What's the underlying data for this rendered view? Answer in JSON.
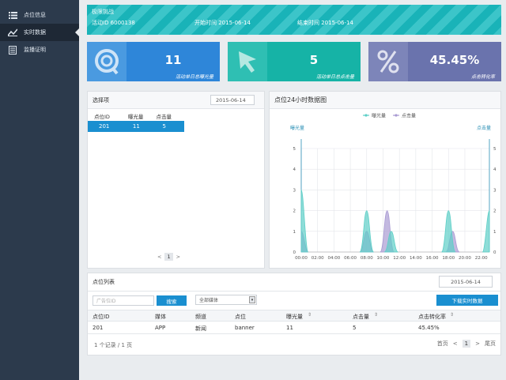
{
  "sidebar": {
    "items": [
      {
        "label": "点位信息",
        "icon": "list-icon"
      },
      {
        "label": "实时数据",
        "icon": "chart-line-icon"
      },
      {
        "label": "监播证明",
        "icon": "document-icon"
      }
    ]
  },
  "banner": {
    "name": "极限挑战",
    "activity_id": "活动ID 6000138",
    "start": "开始时间 2015-06-14",
    "end": "结束时间 2015-06-14"
  },
  "cards": [
    {
      "value": "11",
      "label": "活动单日总曝光量",
      "icon": "magnifier-icon",
      "color": "#2e86d9"
    },
    {
      "value": "5",
      "label": "活动单日总点击量",
      "icon": "cursor-icon",
      "color": "#16b3a6"
    },
    {
      "value": "45.45%",
      "label": "点击转化率",
      "icon": "percent-icon",
      "color": "#6a73ad"
    }
  ],
  "selector": {
    "title": "选择项",
    "date": "2015-06-14",
    "headers": [
      "点位ID",
      "曝光量",
      "点击量"
    ],
    "rows": [
      [
        "201",
        "11",
        "5"
      ]
    ],
    "pager_prev": "<",
    "pager_page": "1",
    "pager_next": ">"
  },
  "chart_title": "点位24小时数据图",
  "chart_data": {
    "type": "area",
    "legend": [
      "曝光量",
      "点击量"
    ],
    "ylabel_left": "曝光量",
    "ylabel_right": "点击量",
    "ylim": [
      0,
      5
    ],
    "yticks": [
      "0",
      "1",
      "2",
      "3",
      "4",
      "5"
    ],
    "xticks": [
      "00:00",
      "02:00",
      "04:00",
      "06:00",
      "08:00",
      "10:00",
      "12:00",
      "14:00",
      "16:00",
      "18:00",
      "20:00",
      "22:00"
    ],
    "series": [
      {
        "name": "曝光量",
        "color": "#5ecfc7",
        "x": [
          0,
          8,
          11,
          18,
          23
        ],
        "values": [
          3,
          2,
          1,
          2,
          2
        ]
      },
      {
        "name": "点击量",
        "color": "#a99bd3",
        "x": [
          0,
          8,
          10.5,
          18.5
        ],
        "values": [
          1,
          1,
          2,
          1
        ]
      }
    ]
  },
  "list": {
    "title": "点位列表",
    "date": "2015-06-14",
    "search_placeholder": "广告位ID",
    "search_btn": "搜索",
    "media_select": "全部媒体",
    "download_btn": "下载实时数据",
    "headers": [
      "点位ID",
      "媒体",
      "频道",
      "点位",
      "曝光量",
      "点击量",
      "点击转化率"
    ],
    "rows": [
      [
        "201",
        "APP",
        "新闻",
        "banner",
        "11",
        "5",
        "45.45%"
      ]
    ],
    "summary": "1 个记录 / 1 页",
    "first": "首页",
    "prev": "<",
    "page": "1",
    "next": ">",
    "last": "尾页"
  }
}
